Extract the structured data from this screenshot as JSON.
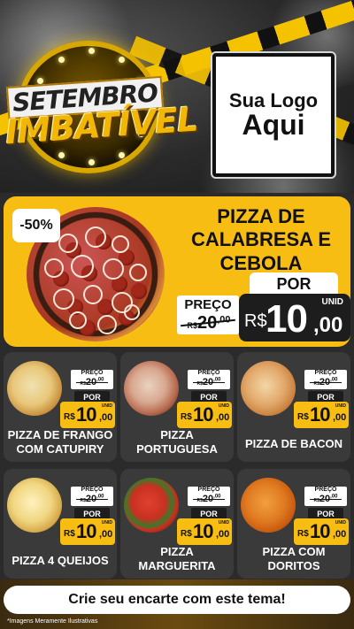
{
  "header": {
    "title_line1": "SETEMBRO",
    "title_line2": "IMBATÍVEL",
    "logo_line1": "Sua Logo",
    "logo_line2": "Aqui"
  },
  "featured": {
    "discount": "-50%",
    "name_lines": [
      "PIZZA DE",
      "CALABRESA E",
      "CEBOLA"
    ],
    "preco_label": "PREÇO",
    "old_currency": "R$",
    "old_int": "20",
    "old_dec": ",00",
    "por_label": "POR",
    "new_currency": "R$",
    "new_int": "10",
    "new_dec": ",00",
    "unit": "UNID"
  },
  "products": [
    {
      "name_lines": [
        "PIZZA DE FRANGO",
        "COM CATUPIRY"
      ],
      "preco_label": "PREÇO",
      "old_currency": "R$",
      "old_int": "20",
      "old_dec": ",00",
      "por_label": "POR",
      "new_currency": "R$",
      "new_int": "10",
      "new_dec": ",00",
      "unit": "UNID"
    },
    {
      "name_lines": [
        "PIZZA",
        "PORTUGUESA"
      ],
      "preco_label": "PREÇO",
      "old_currency": "R$",
      "old_int": "20",
      "old_dec": ",00",
      "por_label": "POR",
      "new_currency": "R$",
      "new_int": "10",
      "new_dec": ",00",
      "unit": "UNID"
    },
    {
      "name_lines": [
        "PIZZA DE BACON",
        ""
      ],
      "preco_label": "PREÇO",
      "old_currency": "R$",
      "old_int": "20",
      "old_dec": ",00",
      "por_label": "POR",
      "new_currency": "R$",
      "new_int": "10",
      "new_dec": ",00",
      "unit": "UNID"
    },
    {
      "name_lines": [
        "PIZZA 4 QUEIJOS",
        ""
      ],
      "preco_label": "PREÇO",
      "old_currency": "R$",
      "old_int": "20",
      "old_dec": ",00",
      "por_label": "POR",
      "new_currency": "R$",
      "new_int": "10",
      "new_dec": ",00",
      "unit": "UNID"
    },
    {
      "name_lines": [
        "PIZZA",
        "MARGUERITA"
      ],
      "preco_label": "PREÇO",
      "old_currency": "R$",
      "old_int": "20",
      "old_dec": ",00",
      "por_label": "POR",
      "new_currency": "R$",
      "new_int": "10",
      "new_dec": ",00",
      "unit": "UNID"
    },
    {
      "name_lines": [
        "PIZZA COM",
        "DORITOS"
      ],
      "preco_label": "PREÇO",
      "old_currency": "R$",
      "old_int": "20",
      "old_dec": ",00",
      "por_label": "POR",
      "new_currency": "R$",
      "new_int": "10",
      "new_dec": ",00",
      "unit": "UNID"
    }
  ],
  "footer": {
    "cta": "Crie seu encarte com este tema!",
    "disclaimer": "*Imagens Meramente Ilustrativas"
  },
  "colors": {
    "accent_yellow": "#f7bd13",
    "dark": "#1d1d1d",
    "card_bg": "#3a3a3a"
  },
  "icons": [
    "pizza-image"
  ]
}
